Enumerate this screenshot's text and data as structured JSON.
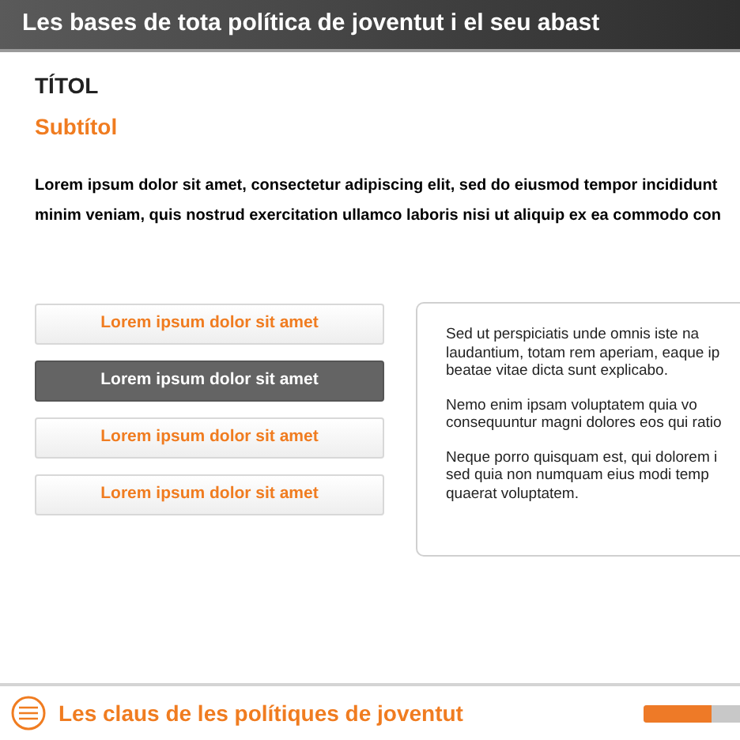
{
  "header": {
    "title": "Les bases de tota política de joventut i el seu abast"
  },
  "title": "TÍTOL",
  "subtitle": "Subtítol",
  "intro_lines": [
    "Lorem ipsum dolor sit amet, consectetur adipiscing elit, sed do eiusmod tempor incididunt",
    "minim veniam, quis nostrud exercitation ullamco laboris nisi ut aliquip ex ea commodo con"
  ],
  "options": [
    {
      "label": "Lorem ipsum dolor sit amet",
      "selected": false
    },
    {
      "label": "Lorem ipsum dolor sit amet",
      "selected": true
    },
    {
      "label": "Lorem ipsum dolor sit amet",
      "selected": false
    },
    {
      "label": "Lorem ipsum dolor sit amet",
      "selected": false
    }
  ],
  "panel": {
    "paragraphs": [
      [
        "Sed ut perspiciatis unde omnis iste na",
        "laudantium, totam rem aperiam, eaque ip",
        "beatae vitae dicta sunt explicabo."
      ],
      [
        "Nemo enim ipsam voluptatem quia vo",
        "consequuntur magni dolores eos qui ratio"
      ],
      [
        "Neque porro quisquam est, qui dolorem i",
        "sed quia non numquam eius modi temp",
        "quaerat voluptatem."
      ]
    ]
  },
  "footer": {
    "title": "Les claus de les polítiques de joventut",
    "progress": {
      "level": 0.7
    }
  }
}
